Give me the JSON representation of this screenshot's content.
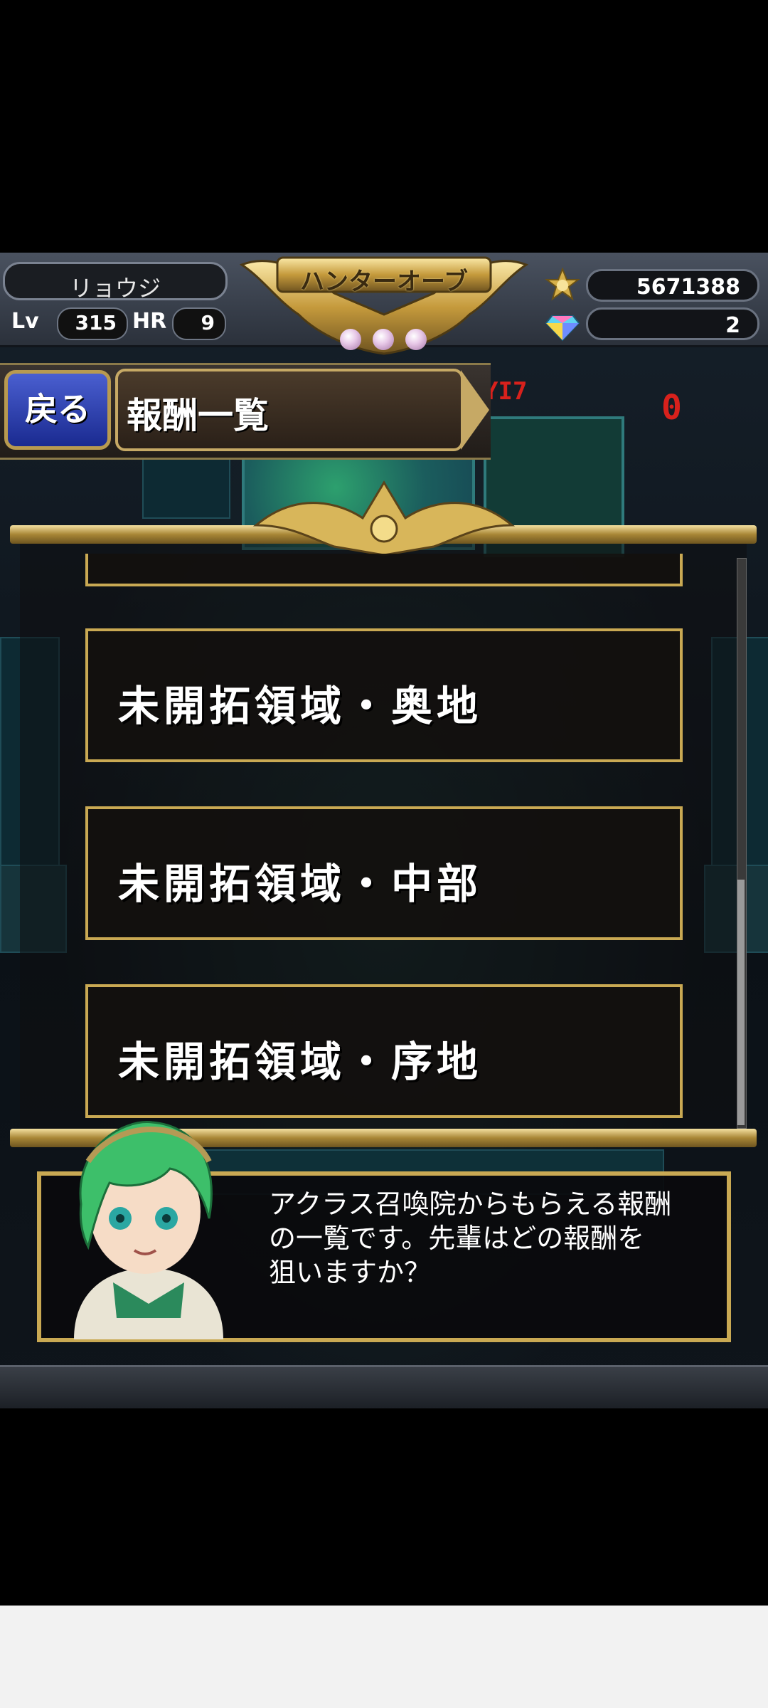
{
  "player": {
    "name": "リョウジ",
    "lv_label": "Lv",
    "level": "315",
    "hr_label": "HR",
    "hunter_rank": "9"
  },
  "header": {
    "title": "ハンターオーブ",
    "medal_count": "5671388",
    "gem_count": "2",
    "orb_count": 3
  },
  "nav": {
    "back_label": "戻る",
    "page_title": "報酬一覧"
  },
  "list": {
    "items": [
      "未開拓領域・奥地",
      "未開拓領域・中部",
      "未開拓領域・序地"
    ]
  },
  "dialog": {
    "line1": "アクラス召喚院からもらえる報酬",
    "line2": "の一覧です。先輩はどの報酬を",
    "line3": "狙いますか？"
  },
  "icons": {
    "medal": "medal-icon",
    "gem": "gem-icon",
    "portrait": "character-portrait"
  },
  "colors": {
    "gold": "#c9a953",
    "back_button": "#2a3db0"
  }
}
